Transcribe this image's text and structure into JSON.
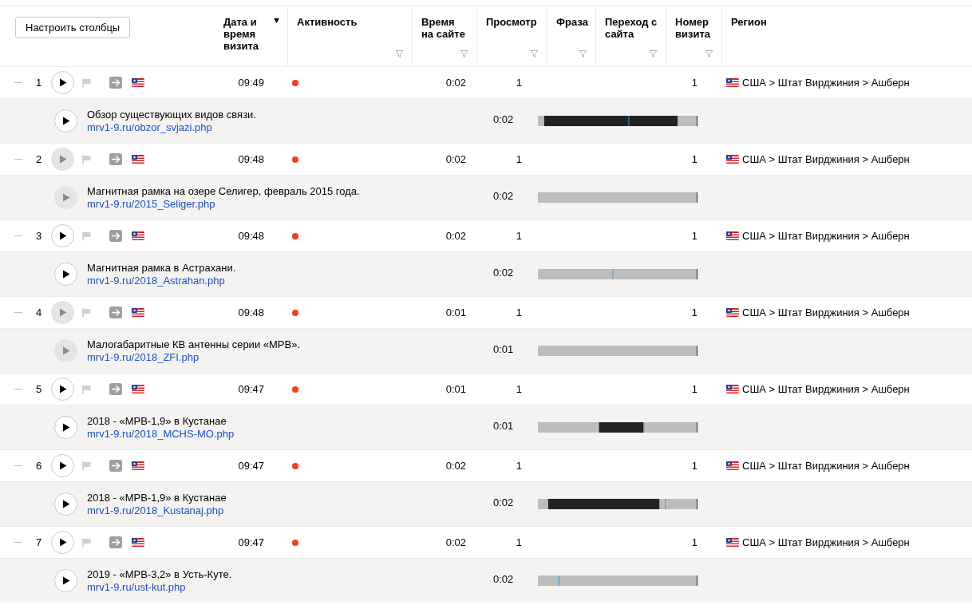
{
  "configure_button": "Настроить столбцы",
  "columns": [
    {
      "label": "Дата и время визита",
      "sorted": true,
      "filter": false
    },
    {
      "label": "Активность",
      "sorted": false,
      "filter": true
    },
    {
      "label": "Время на сайте",
      "sorted": false,
      "filter": true
    },
    {
      "label": "Просмотр",
      "sorted": false,
      "filter": true
    },
    {
      "label": "Фраза",
      "sorted": false,
      "filter": true
    },
    {
      "label": "Переход с сайта",
      "sorted": false,
      "filter": true
    },
    {
      "label": "Номер визита",
      "sorted": false,
      "filter": true
    },
    {
      "label": "Регион",
      "sorted": false,
      "filter": false
    }
  ],
  "visits": [
    {
      "number": "1",
      "play_disabled": false,
      "time": "09:49",
      "duration": "0:02",
      "views": "1",
      "visit_number": "1",
      "region": "США > Штат Вирджиния > Ашберн",
      "page": {
        "title": "Обзор существующих видов связи.",
        "url": "mrv1-9.ru/obzor_svjazi.php",
        "play_disabled": false,
        "duration": "0:02"
      }
    },
    {
      "number": "2",
      "play_disabled": true,
      "time": "09:48",
      "duration": "0:02",
      "views": "1",
      "visit_number": "1",
      "region": "США > Штат Вирджиния > Ашберн",
      "page": {
        "title": "Магнитная рамка на озере Селигер, февраль 2015 года.",
        "url": "mrv1-9.ru/2015_Seliger.php",
        "play_disabled": true,
        "duration": "0:02"
      }
    },
    {
      "number": "3",
      "play_disabled": false,
      "time": "09:48",
      "duration": "0:02",
      "views": "1",
      "visit_number": "1",
      "region": "США > Штат Вирджиния > Ашберн",
      "page": {
        "title": "Магнитная рамка в Астрахани.",
        "url": "mrv1-9.ru/2018_Astrahan.php",
        "play_disabled": false,
        "duration": "0:02"
      }
    },
    {
      "number": "4",
      "play_disabled": true,
      "time": "09:48",
      "duration": "0:01",
      "views": "1",
      "visit_number": "1",
      "region": "США > Штат Вирджиния > Ашберн",
      "page": {
        "title": "Малогабаритные КВ антенны серии «МРВ».",
        "url": "mrv1-9.ru/2018_ZFI.php",
        "play_disabled": true,
        "duration": "0:01"
      }
    },
    {
      "number": "5",
      "play_disabled": false,
      "time": "09:47",
      "duration": "0:01",
      "views": "1",
      "visit_number": "1",
      "region": "США > Штат Вирджиния > Ашберн",
      "page": {
        "title": "2018 - «МРВ-1,9» в Кустанае",
        "url": "mrv1-9.ru/2018_MCHS-MO.php",
        "play_disabled": false,
        "duration": "0:01"
      }
    },
    {
      "number": "6",
      "play_disabled": false,
      "time": "09:47",
      "duration": "0:02",
      "views": "1",
      "visit_number": "1",
      "region": "США > Штат Вирджиния > Ашберн",
      "page": {
        "title": "2018 - «МРВ-1,9» в Кустанае",
        "url": "mrv1-9.ru/2018_Kustanaj.php",
        "play_disabled": false,
        "duration": "0:02"
      }
    },
    {
      "number": "7",
      "play_disabled": false,
      "time": "09:47",
      "duration": "0:02",
      "views": "1",
      "visit_number": "1",
      "region": "США > Штат Вирджиния > Ашберн",
      "page": {
        "title": "2019 - «МРВ-3,2» в Усть-Куте.",
        "url": "mrv1-9.ru/ust-kut.php",
        "play_disabled": false,
        "duration": "0:02"
      }
    }
  ]
}
